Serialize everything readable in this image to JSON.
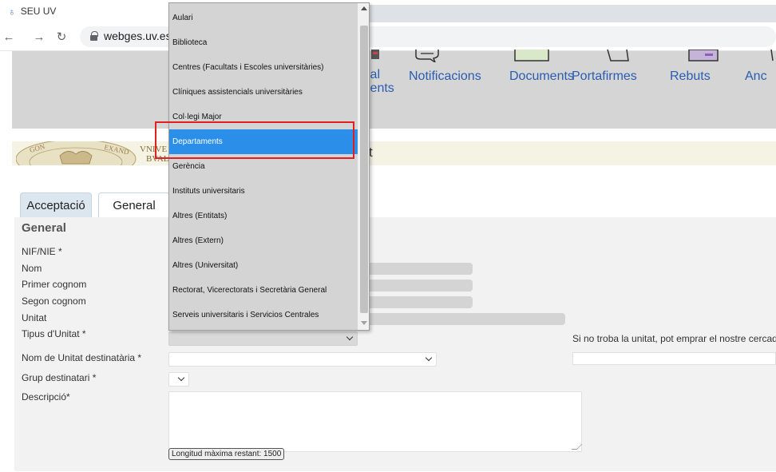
{
  "browser": {
    "tab_title": "SEU UV",
    "url": "webges.uv.es/"
  },
  "site_nav": {
    "items": [
      {
        "label": "ial",
        "label2": "ients"
      },
      {
        "label": "Notificacions"
      },
      {
        "label": "Documents"
      },
      {
        "label": "Portafirmes"
      },
      {
        "label": "Rebuts"
      },
      {
        "label": "Anc"
      }
    ]
  },
  "university_bar": {
    "logo_text_1": "VNIVE",
    "logo_text_2": "BVAL",
    "trailing_text": "t"
  },
  "form": {
    "tabs": [
      {
        "label": "Acceptació",
        "active": false
      },
      {
        "label": "General",
        "active": true
      }
    ],
    "section_title": "General",
    "labels": {
      "nif": "NIF/NIE *",
      "nom": "Nom",
      "primer_cognom": "Primer cognom",
      "segon_cognom": "Segon cognom",
      "unitat": "Unitat",
      "tipus_unitat": "Tipus d'Unitat *",
      "nom_unitat_desti": "Nom de Unitat destinatària *",
      "grup_destinatari": "Grup destinatari *",
      "descripcio": "Descripció*"
    },
    "help_text": "Si no troba la unitat, pot emprar el nostre cercado",
    "counter": "Longitud màxima restant: 1500"
  },
  "dropdown": {
    "options": [
      "Aulari",
      "Biblioteca",
      "Centres (Facultats i Escoles universitàries)",
      "Clíniques assistencials universitàries",
      "Col·legi Major",
      "Departaments",
      "Gerència",
      "Instituts universitaris",
      "Altres (Entitats)",
      "Altres (Extern)",
      "Altres (Universitat)",
      "Rectorat, Vicerectorats i Secretària General",
      "Serveis universitaris i Servicios Centrales"
    ],
    "selected_index": 5
  },
  "colors": {
    "selected_option": "#2b8fe9",
    "nav_link": "#2a5db0",
    "highlight": "#e02020",
    "header_bg": "#d5d5d5"
  }
}
